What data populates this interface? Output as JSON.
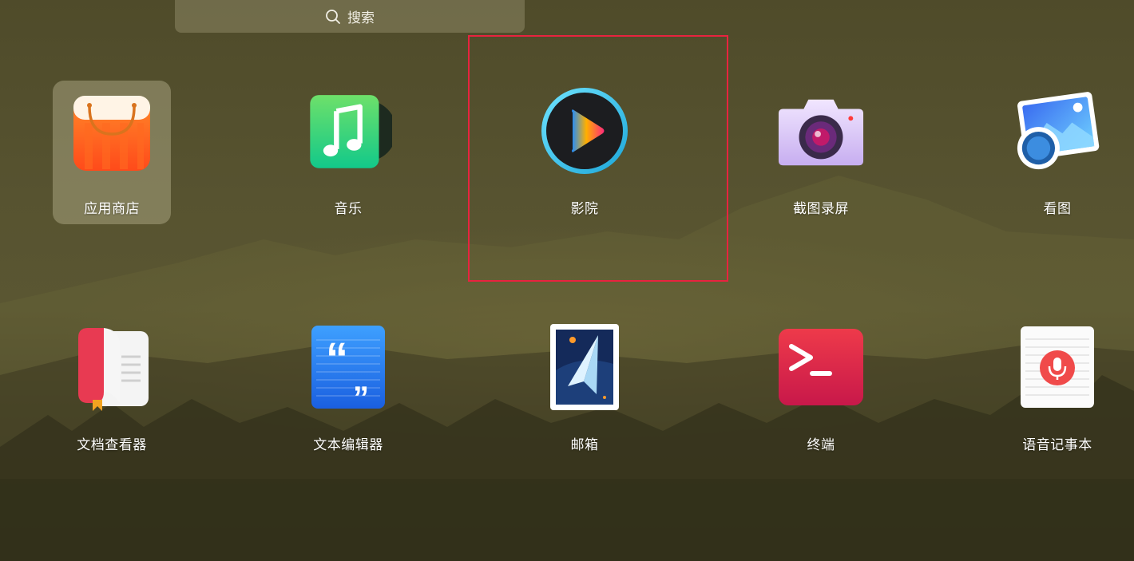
{
  "search": {
    "placeholder": "搜索",
    "icon": "search-icon"
  },
  "apps": [
    {
      "id": "app-store",
      "label": "应用商店",
      "icon": "shopping-bag-icon",
      "selected": true
    },
    {
      "id": "music",
      "label": "音乐",
      "icon": "music-note-icon"
    },
    {
      "id": "movie",
      "label": "影院",
      "icon": "play-icon",
      "focused": true
    },
    {
      "id": "screenshot",
      "label": "截图录屏",
      "icon": "camera-icon"
    },
    {
      "id": "image-viewer",
      "label": "看图",
      "icon": "picture-icon"
    },
    {
      "id": "document-viewer",
      "label": "文档查看器",
      "icon": "book-icon"
    },
    {
      "id": "text-editor",
      "label": "文本编辑器",
      "icon": "quote-icon"
    },
    {
      "id": "mail",
      "label": "邮箱",
      "icon": "paper-plane-icon"
    },
    {
      "id": "terminal",
      "label": "终端",
      "icon": "terminal-icon"
    },
    {
      "id": "voice-note",
      "label": "语音记事本",
      "icon": "microphone-icon"
    }
  ],
  "colors": {
    "focus_frame": "#e8233f",
    "selected_bg": "#bdb996"
  }
}
